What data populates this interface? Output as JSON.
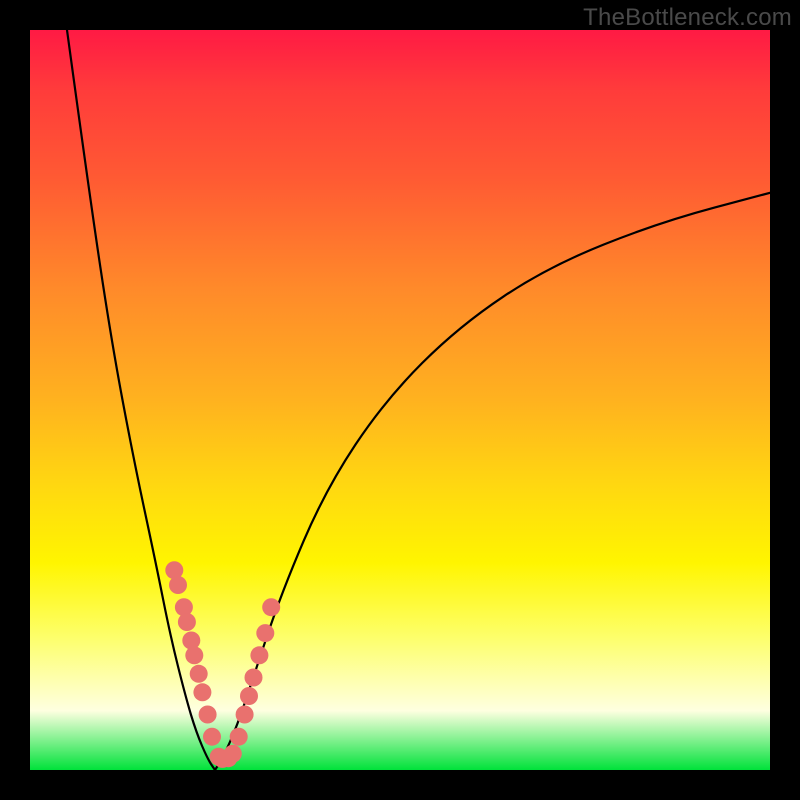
{
  "watermark": "TheBottleneck.com",
  "colors": {
    "frame": "#000000",
    "curve": "#000000",
    "dot": "#e9716e",
    "gradient_stops": [
      "#ff1a44",
      "#ff3b3b",
      "#ff5a33",
      "#ff8a2a",
      "#ffb21f",
      "#ffd910",
      "#fff500",
      "#fdff6a",
      "#feffe0",
      "#00e23a"
    ]
  },
  "chart_data": {
    "type": "line",
    "title": "",
    "xlabel": "",
    "ylabel": "",
    "xlim": [
      0,
      100
    ],
    "ylim": [
      0,
      100
    ],
    "curve": {
      "description": "V-shaped bottleneck curve; left branch steep, right branch shallow asymptotic",
      "min_x": 25,
      "min_y": 0
    },
    "series": [
      {
        "name": "curve-left",
        "x": [
          5,
          8,
          11,
          14,
          17,
          19,
          21,
          22.5,
          24,
          25
        ],
        "y": [
          100,
          78,
          58,
          42,
          28,
          18,
          10,
          5,
          1.5,
          0
        ]
      },
      {
        "name": "curve-right",
        "x": [
          25,
          26,
          28,
          30,
          34,
          40,
          48,
          58,
          70,
          85,
          100
        ],
        "y": [
          0,
          1.5,
          6,
          12,
          24,
          38,
          50,
          60,
          68,
          74,
          78
        ]
      },
      {
        "name": "dots",
        "x": [
          19.5,
          20,
          20.8,
          21.2,
          21.8,
          22.2,
          22.8,
          23.3,
          24,
          24.6,
          25.5,
          26,
          26.8,
          27.4,
          28.2,
          29,
          29.6,
          30.2,
          31,
          31.8,
          32.6
        ],
        "y": [
          27,
          25,
          22,
          20,
          17.5,
          15.5,
          13,
          10.5,
          7.5,
          4.5,
          1.8,
          1.5,
          1.6,
          2.2,
          4.5,
          7.5,
          10,
          12.5,
          15.5,
          18.5,
          22
        ]
      }
    ]
  }
}
